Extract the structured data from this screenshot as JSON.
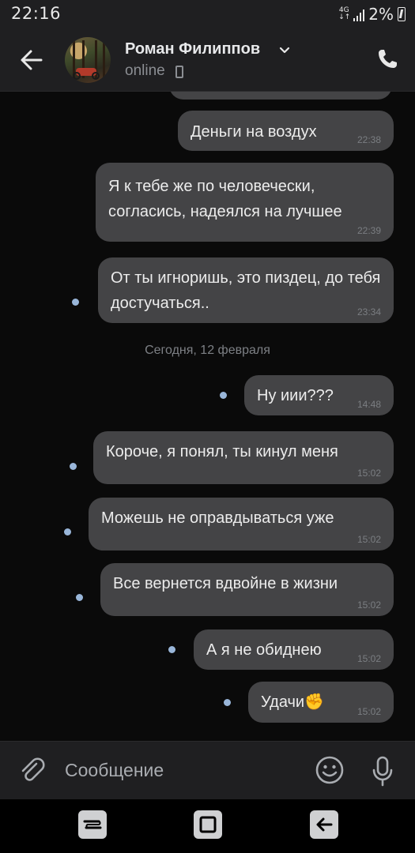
{
  "status_bar": {
    "time": "22:16",
    "network": "4G",
    "battery": "2%"
  },
  "header": {
    "contact_name": "Роман Филиппов",
    "contact_status": "online",
    "icons": [
      "back-arrow-icon",
      "chevron-down-icon",
      "mobile-icon",
      "phone-icon"
    ]
  },
  "messages": [
    {
      "text": "Деньги на воздух",
      "time": "22:38",
      "unread": false
    },
    {
      "text": "Я к тебе же по человечески, согласись, надеялся на лучшее",
      "time": "22:39",
      "unread": false
    },
    {
      "text": "От ты игноришь, это пиздец, до тебя достучаться..",
      "time": "23:34",
      "unread": true
    },
    {
      "text": "Ну иии???",
      "time": "14:48",
      "unread": true
    },
    {
      "text": "Короче, я понял, ты кинул меня",
      "time": "15:02",
      "unread": true
    },
    {
      "text": "Можешь не оправдываться уже",
      "time": "15:02",
      "unread": true
    },
    {
      "text": "Все вернется вдвойне в жизни",
      "time": "15:02",
      "unread": true
    },
    {
      "text": "А я не обиднею",
      "time": "15:02",
      "unread": true
    },
    {
      "text": "Удачи✊",
      "time": "15:02",
      "unread": true
    }
  ],
  "date_separator": "Сегодня, 12 февраля",
  "composer": {
    "placeholder": "Сообщение",
    "icons": [
      "paperclip-icon",
      "emoji-icon",
      "microphone-icon"
    ]
  },
  "colors": {
    "bubble": "#444446",
    "chat_background": "#0a0a0a",
    "header_background": "#1f1f21",
    "unread_dot": "#99b6d9"
  }
}
